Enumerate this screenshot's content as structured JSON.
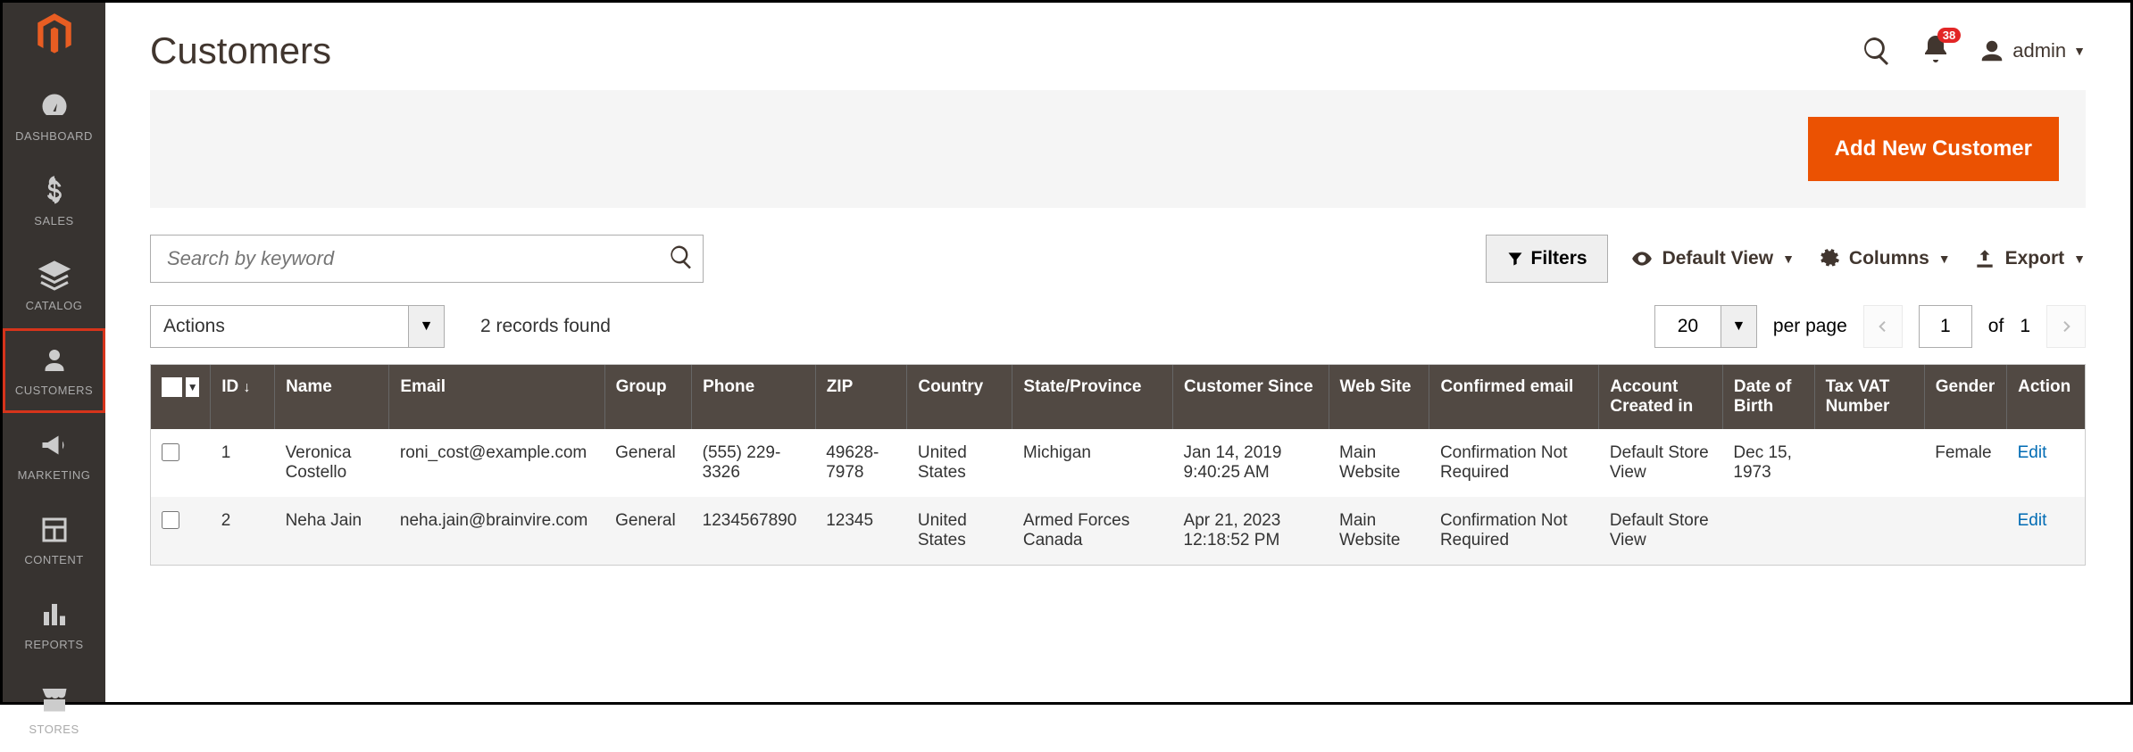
{
  "colors": {
    "accent": "#eb5202",
    "badge": "#e22626"
  },
  "sidebar": {
    "items": [
      {
        "label": "DASHBOARD"
      },
      {
        "label": "SALES"
      },
      {
        "label": "CATALOG"
      },
      {
        "label": "CUSTOMERS"
      },
      {
        "label": "MARKETING"
      },
      {
        "label": "CONTENT"
      },
      {
        "label": "REPORTS"
      },
      {
        "label": "STORES"
      }
    ]
  },
  "header": {
    "title": "Customers",
    "notification_count": "38",
    "user_label": "admin"
  },
  "banner": {
    "primary_button": "Add New Customer"
  },
  "toolbar": {
    "search_placeholder": "Search by keyword",
    "filters_label": "Filters",
    "view_label": "Default View",
    "columns_label": "Columns",
    "export_label": "Export"
  },
  "actions": {
    "select_label": "Actions",
    "records_found": "2 records found",
    "page_size": "20",
    "per_page_label": "per page",
    "page_current": "1",
    "page_total": "1",
    "of_label": "of"
  },
  "grid": {
    "columns": [
      "",
      "ID",
      "Name",
      "Email",
      "Group",
      "Phone",
      "ZIP",
      "Country",
      "State/Province",
      "Customer Since",
      "Web Site",
      "Confirmed email",
      "Account Created in",
      "Date of Birth",
      "Tax VAT Number",
      "Gender",
      "Action"
    ],
    "rows": [
      {
        "id": "1",
        "name": "Veronica Costello",
        "email": "roni_cost@example.com",
        "group": "General",
        "phone": "(555) 229-3326",
        "zip": "49628-7978",
        "country": "United States",
        "state": "Michigan",
        "since": "Jan 14, 2019 9:40:25 AM",
        "website": "Main Website",
        "confirmed": "Confirmation Not Required",
        "created_in": "Default Store View",
        "dob": "Dec 15, 1973",
        "tax": "",
        "gender": "Female",
        "action": "Edit"
      },
      {
        "id": "2",
        "name": "Neha Jain",
        "email": "neha.jain@brainvire.com",
        "group": "General",
        "phone": "1234567890",
        "zip": "12345",
        "country": "United States",
        "state": "Armed Forces Canada",
        "since": "Apr 21, 2023 12:18:52 PM",
        "website": "Main Website",
        "confirmed": "Confirmation Not Required",
        "created_in": "Default Store View",
        "dob": "",
        "tax": "",
        "gender": "",
        "action": "Edit"
      }
    ]
  }
}
